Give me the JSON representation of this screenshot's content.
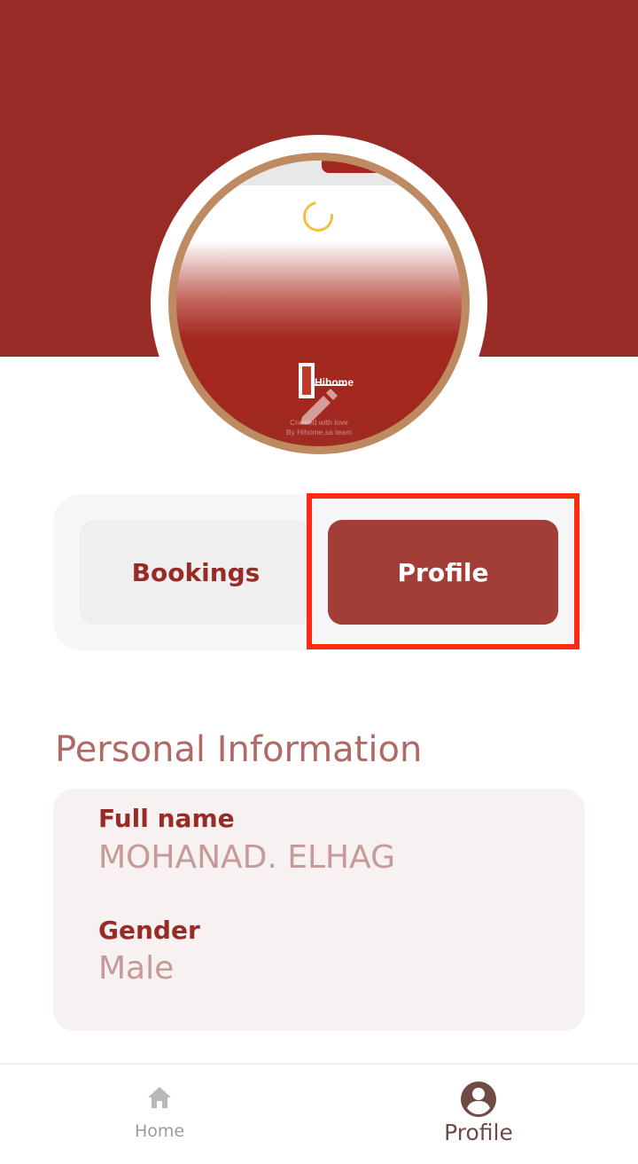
{
  "avatar": {
    "logo_text": "Hihome",
    "caption_line1": "Created with love",
    "caption_line2": "By Hihome.sa team"
  },
  "tabs": [
    {
      "label": "Bookings",
      "selected": false
    },
    {
      "label": "Profile",
      "selected": true
    }
  ],
  "personal_info": {
    "title": "Personal Information",
    "fields": [
      {
        "label": "Full name",
        "value": "MOHANAD. ELHAG"
      },
      {
        "label": "Gender",
        "value": "Male"
      }
    ]
  },
  "bottom_nav": {
    "items": [
      {
        "label": "Home",
        "icon": "home-icon",
        "active": false
      },
      {
        "label": "Profile",
        "icon": "account-circle-icon",
        "active": true
      }
    ]
  },
  "colors": {
    "brand": "#982b25",
    "active_tab": "#a33d38",
    "highlight": "#ff2a10",
    "avatar_ring": "#be8a62"
  }
}
